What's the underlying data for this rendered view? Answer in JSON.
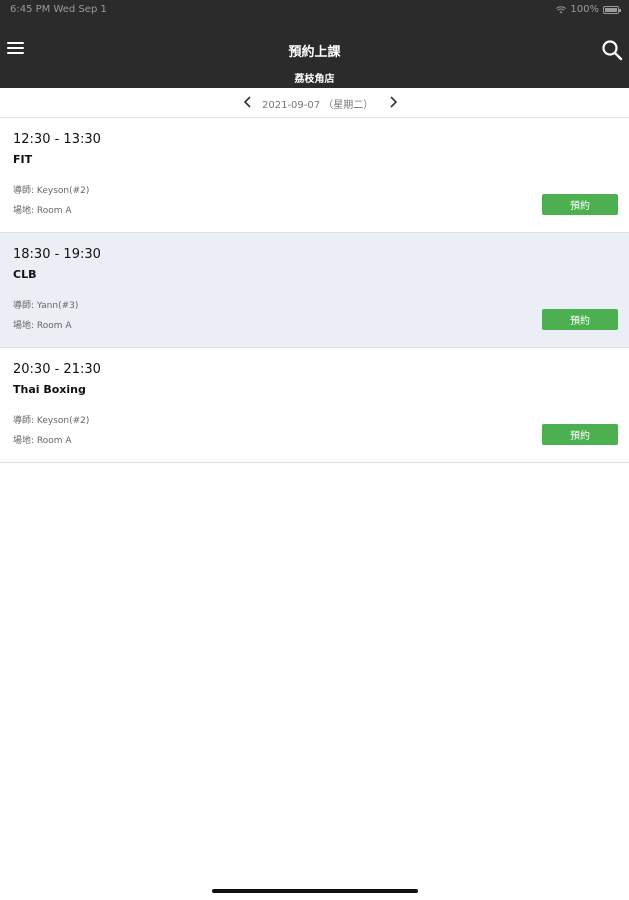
{
  "status_bar": {
    "time_date": "6:45 PM  Wed Sep 1",
    "battery": "100%",
    "wifi_icon": "wifi-icon",
    "battery_icon": "battery-icon"
  },
  "header": {
    "title": "預約上課",
    "subtitle": "荔枝角店",
    "menu_icon": "hamburger-menu-icon",
    "search_icon": "search-icon"
  },
  "date_nav": {
    "date_label": "2021-09-07 （星期二）",
    "prev_icon": "chevron-left-icon",
    "next_icon": "chevron-right-icon"
  },
  "classes": [
    {
      "time": "12:30 - 13:30",
      "name": "FIT",
      "coach": "導師: Keyson(#2)",
      "room": "場地: Room A",
      "button_label": "預約"
    },
    {
      "time": "18:30 - 19:30",
      "name": "CLB",
      "coach": "導師: Yann(#3)",
      "room": "場地: Room A",
      "button_label": "預約"
    },
    {
      "time": "20:30 - 21:30",
      "name": "Thai Boxing",
      "coach": "導師: Keyson(#2)",
      "room": "場地: Room A",
      "button_label": "預約"
    }
  ],
  "colors": {
    "header_bg": "#2b2b2b",
    "highlight_row_bg": "#eceef5",
    "book_button": "#4caf50"
  }
}
